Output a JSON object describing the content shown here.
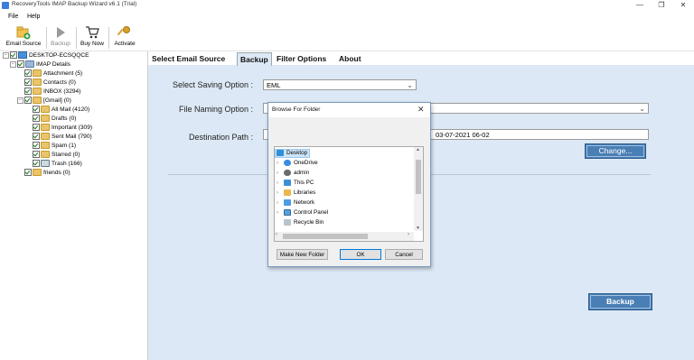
{
  "window": {
    "title": "RecoveryTools IMAP Backup Wizard v6.1 (Trial)",
    "min_glyph": "—",
    "max_glyph": "❐",
    "close_glyph": "✕"
  },
  "menu": [
    "File",
    "Help"
  ],
  "toolbar": {
    "email_source": "Email Source",
    "backup": "Backup",
    "buy_now": "Buy Now",
    "activate": "Activate"
  },
  "tree": {
    "root": "DESKTOP-ECSQQCE",
    "imap": "IMAP Details",
    "items": [
      "Attachment (5)",
      "Contacts (0)",
      "INBOX (3294)",
      "[Gmail] (0)"
    ],
    "gmail_items": [
      "All Mail (4120)",
      "Drafts (0)",
      "Important (309)",
      "Sent Mail (790)",
      "Spam (1)",
      "Starred (0)",
      "Trash (166)"
    ],
    "friends": "friends (0)"
  },
  "tabs": [
    "Select Email Source",
    "Backup",
    "Filter Options",
    "About"
  ],
  "backup": {
    "saving_label": "Select Saving Option :",
    "saving_value": "EML",
    "naming_label": "File Naming Option :",
    "dest_label": "Destination Path :",
    "dest_value_visible": "03-07-2021 06-02",
    "change_button": "Change...",
    "backup_button": "Backup"
  },
  "dialog": {
    "title": "Browse For Folder",
    "close": "✕",
    "items": [
      "Desktop",
      "OneDrive",
      "admin",
      "This PC",
      "Libraries",
      "Network",
      "Control Panel",
      "Recycle Bin"
    ],
    "make_new": "Make New Folder",
    "ok": "OK",
    "cancel": "Cancel"
  },
  "colors": {
    "panel": "#dce8f5",
    "accent_button": "#4a7fb5",
    "selection": "#cce4f7"
  }
}
